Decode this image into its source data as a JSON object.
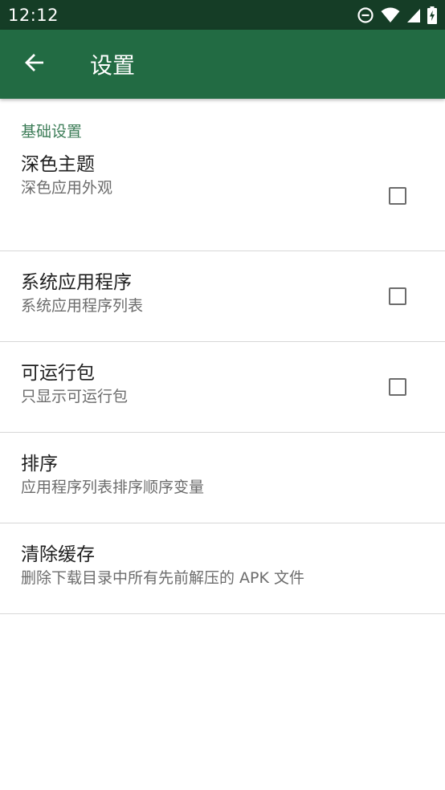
{
  "status_bar": {
    "time": "12:12",
    "icons": [
      "do-not-disturb-icon",
      "wifi-icon",
      "signal-icon",
      "battery-charging-icon"
    ]
  },
  "app_bar": {
    "title": "设置",
    "back_icon": "arrow-back-icon"
  },
  "colors": {
    "status_bar": "#153d26",
    "app_bar": "#226b43",
    "section_header": "#3d7d58"
  },
  "section": {
    "header": "基础设置"
  },
  "preferences": [
    {
      "title": "深色主题",
      "summary": "深色应用外观",
      "checkbox": true,
      "checked": false
    },
    {
      "title": "系统应用程序",
      "summary": "系统应用程序列表",
      "checkbox": true,
      "checked": false
    },
    {
      "title": "可运行包",
      "summary": "只显示可运行包",
      "checkbox": true,
      "checked": false
    },
    {
      "title": "排序",
      "summary": "应用程序列表排序顺序变量",
      "checkbox": false
    },
    {
      "title": "清除缓存",
      "summary": "删除下载目录中所有先前解压的 APK 文件",
      "checkbox": false
    }
  ]
}
